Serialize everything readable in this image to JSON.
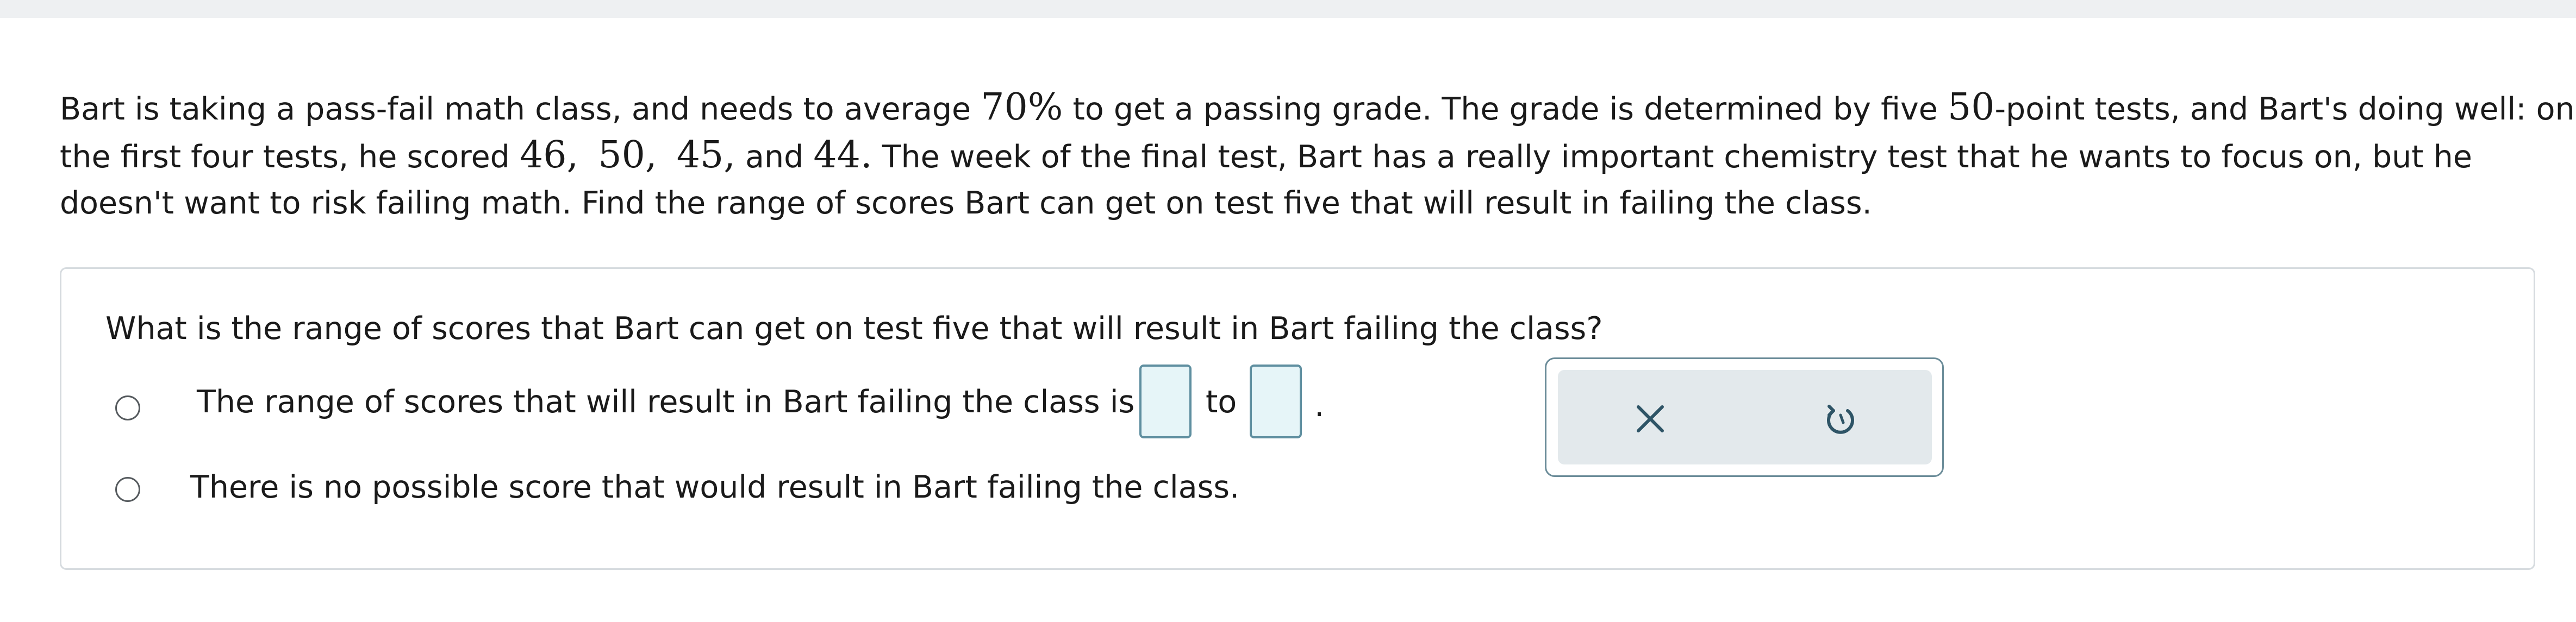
{
  "problem": {
    "line1_a": "Bart is taking a pass-fail math class, and needs to average ",
    "line1_math1": "70%",
    "line1_b": " to get a passing grade. The grade is determined by five ",
    "line1_math2": "50",
    "line1_c": "-point tests, and Bart's doing well: on",
    "line2_a": "the first four tests, he scored ",
    "score1": "46,",
    "score2": "50,",
    "score3": "45,",
    "line2_and": " and ",
    "score4": "44.",
    "line2_b": " The week of the final test, Bart has a really important chemistry test that he wants to focus on, but he",
    "line3": "doesn't want to risk failing math. Find the range of scores Bart can get on test five that will result in failing the class."
  },
  "question": {
    "text": "What is the range of scores that Bart can get on test five that will result in Bart failing the class?",
    "option1": {
      "label": "The range of scores that will result in Bart failing the class is",
      "to": "to",
      "period": "."
    },
    "option2": {
      "label": "There is no possible score that would result in Bart failing the class."
    }
  },
  "tools": {
    "clear_icon": "close-icon",
    "undo_icon": "undo-icon",
    "icon_color": "#2e5466"
  }
}
